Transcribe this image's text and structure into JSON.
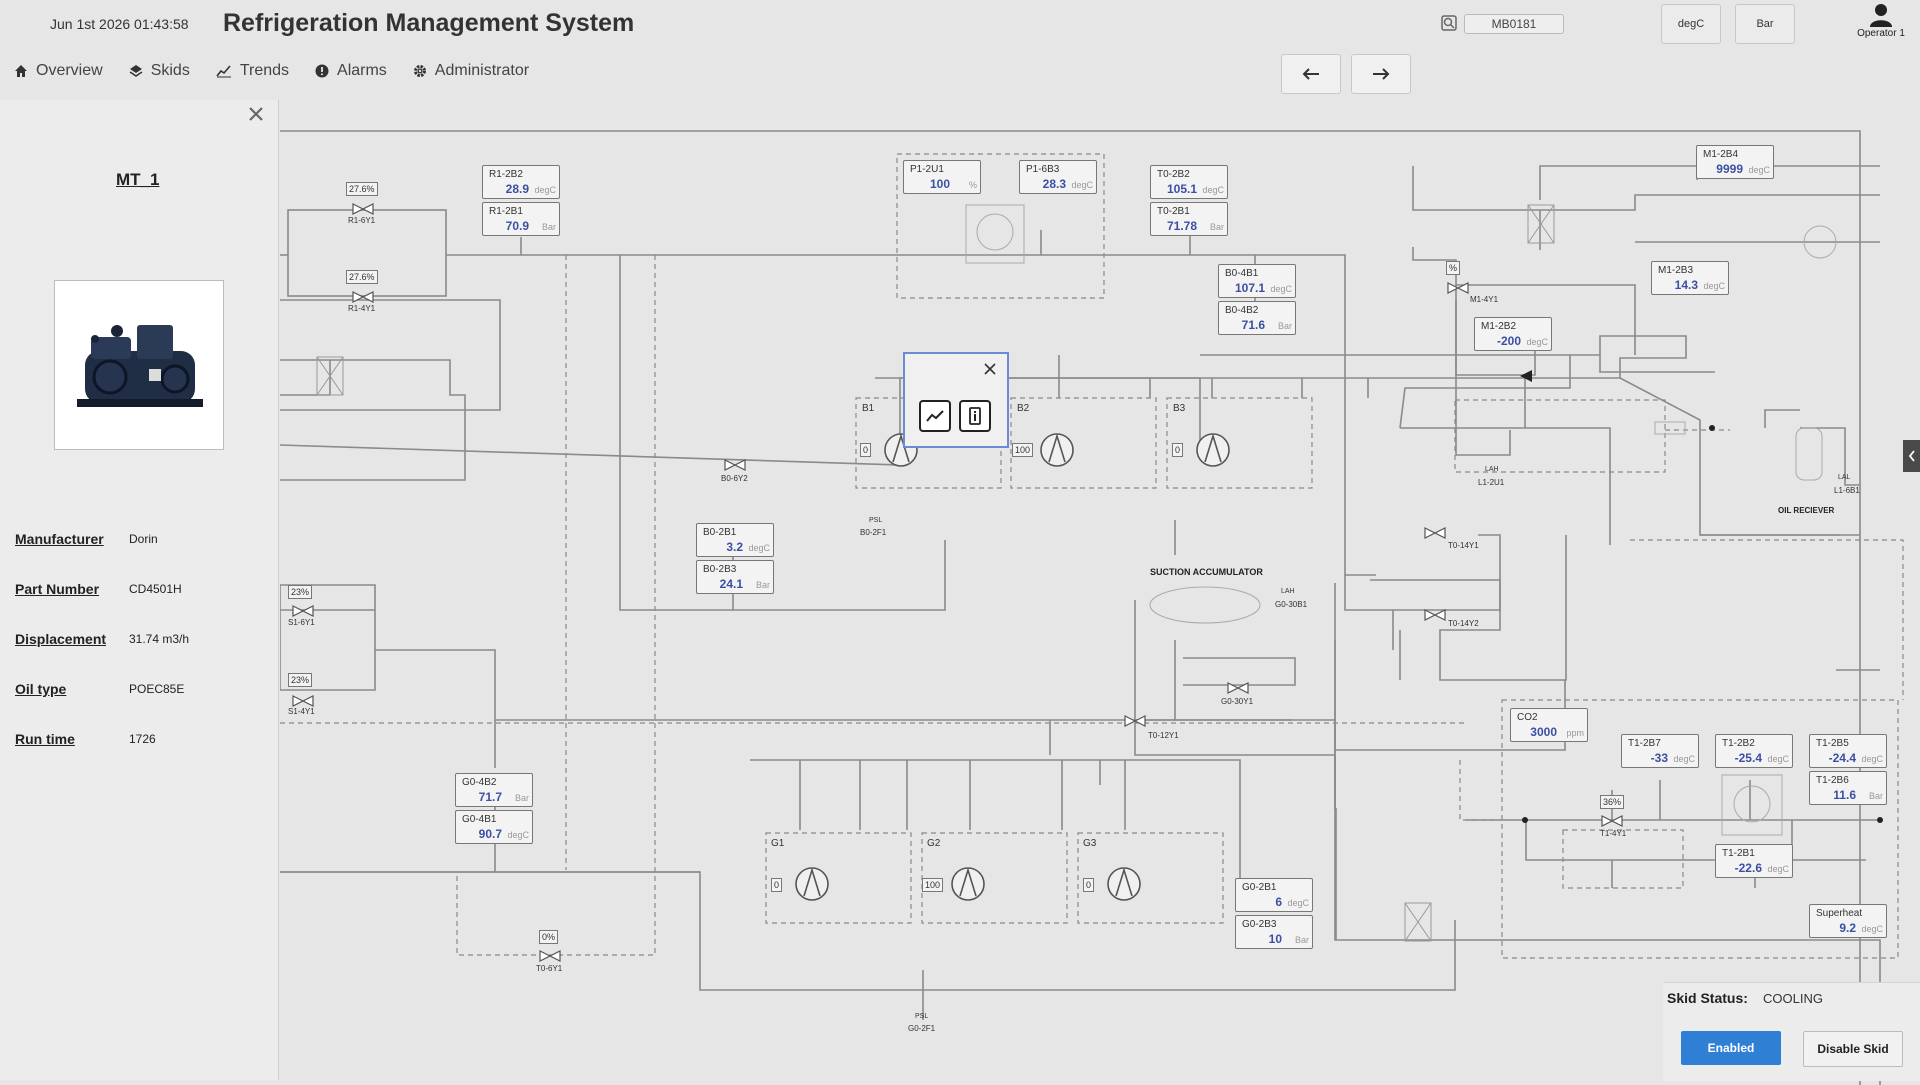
{
  "header": {
    "datetime": "Jun 1st 2026 01:43:58",
    "title": "Refrigeration Management System",
    "search_value": "MB0181",
    "unit_temp": "degC",
    "unit_pressure": "Bar",
    "user": "Operator 1"
  },
  "nav": {
    "items": [
      {
        "label": "Overview",
        "icon": "home-icon"
      },
      {
        "label": "Skids",
        "icon": "layers-icon"
      },
      {
        "label": "Trends",
        "icon": "trend-icon"
      },
      {
        "label": "Alarms",
        "icon": "alert-icon"
      },
      {
        "label": "Administrator",
        "icon": "gear-icon"
      }
    ]
  },
  "panel": {
    "title": "MT_1",
    "properties": [
      {
        "label": "Manufacturer",
        "value": "Dorin"
      },
      {
        "label": "Part Number",
        "value": "CD4501H"
      },
      {
        "label": "Displacement",
        "value": "31.74 m3/h"
      },
      {
        "label": "Oil type",
        "value": "POEC85E"
      },
      {
        "label": "Run time",
        "value": "1726"
      }
    ]
  },
  "sensors": [
    {
      "id": "r1_2b2",
      "tag": "R1-2B2",
      "value": "28.9",
      "unit": "degC"
    },
    {
      "id": "r1_2b1",
      "tag": "R1-2B1",
      "value": "70.9",
      "unit": "Bar"
    },
    {
      "id": "p1_2u1",
      "tag": "P1-2U1",
      "value": "100",
      "unit": "%"
    },
    {
      "id": "p1_6b3",
      "tag": "P1-6B3",
      "value": "28.3",
      "unit": "degC"
    },
    {
      "id": "t0_2b2",
      "tag": "T0-2B2",
      "value": "105.1",
      "unit": "degC"
    },
    {
      "id": "t0_2b1",
      "tag": "T0-2B1",
      "value": "71.78",
      "unit": "Bar"
    },
    {
      "id": "b0_4b1",
      "tag": "B0-4B1",
      "value": "107.1",
      "unit": "degC"
    },
    {
      "id": "b0_4b2",
      "tag": "B0-4B2",
      "value": "71.6",
      "unit": "Bar"
    },
    {
      "id": "m1_2b4",
      "tag": "M1-2B4",
      "value": "9999",
      "unit": "degC"
    },
    {
      "id": "m1_2b3",
      "tag": "M1-2B3",
      "value": "14.3",
      "unit": "degC"
    },
    {
      "id": "m1_2b2",
      "tag": "M1-2B2",
      "value": "-200",
      "unit": "degC"
    },
    {
      "id": "b0_2b1",
      "tag": "B0-2B1",
      "value": "3.2",
      "unit": "degC"
    },
    {
      "id": "b0_2b3",
      "tag": "B0-2B3",
      "value": "24.1",
      "unit": "Bar"
    },
    {
      "id": "g0_4b2",
      "tag": "G0-4B2",
      "value": "71.7",
      "unit": "Bar"
    },
    {
      "id": "g0_4b1",
      "tag": "G0-4B1",
      "value": "90.7",
      "unit": "degC"
    },
    {
      "id": "g0_2b1",
      "tag": "G0-2B1",
      "value": "6",
      "unit": "degC"
    },
    {
      "id": "g0_2b3",
      "tag": "G0-2B3",
      "value": "10",
      "unit": "Bar"
    },
    {
      "id": "co2",
      "tag": "CO2",
      "value": "3000",
      "unit": "ppm"
    },
    {
      "id": "t1_2b7",
      "tag": "T1-2B7",
      "value": "-33",
      "unit": "degC"
    },
    {
      "id": "t1_2b2",
      "tag": "T1-2B2",
      "value": "-25.4",
      "unit": "degC"
    },
    {
      "id": "t1_2b5",
      "tag": "T1-2B5",
      "value": "-24.4",
      "unit": "degC"
    },
    {
      "id": "t1_2b6",
      "tag": "T1-2B6",
      "value": "11.6",
      "unit": "Bar"
    },
    {
      "id": "t1_2b1",
      "tag": "T1-2B1",
      "value": "-22.6",
      "unit": "degC"
    },
    {
      "id": "superheat",
      "tag": "Superheat",
      "value": "9.2",
      "unit": "degC"
    }
  ],
  "valves": {
    "r1_6y1": {
      "pct": "27.6%",
      "tag": "R1-6Y1"
    },
    "r1_4y1": {
      "pct": "27.6%",
      "tag": "R1-4Y1"
    },
    "s1_6y1": {
      "pct": "23%",
      "tag": "S1-6Y1"
    },
    "s1_4y1": {
      "pct": "23%",
      "tag": "S1-4Y1"
    },
    "t0_6y1": {
      "pct": "0%",
      "tag": "T0-6Y1"
    },
    "t1_4y1": {
      "pct": "36%",
      "tag": "T1-4Y1"
    },
    "m1_4y1": {
      "pct": "%",
      "tag": "M1-4Y1"
    },
    "b0_6y2": {
      "tag": "B0-6Y2"
    },
    "t0_14y1": {
      "tag": "T0-14Y1"
    },
    "t0_14y2": {
      "tag": "T0-14Y2"
    },
    "g0_30y1": {
      "tag": "G0-30Y1"
    },
    "t0_12y1": {
      "tag": "T0-12Y1"
    }
  },
  "compressors": {
    "b1": {
      "label": "B1",
      "speed": "0"
    },
    "b2": {
      "label": "B2",
      "speed": "100"
    },
    "b3": {
      "label": "B3",
      "speed": "0"
    },
    "g1": {
      "label": "G1",
      "speed": "0"
    },
    "g2": {
      "label": "G2",
      "speed": "100"
    },
    "g3": {
      "label": "G3",
      "speed": "0"
    }
  },
  "labels": {
    "suction_accumulator": "SUCTION ACCUMULATOR",
    "oil_receiver": "OIL RECIEVER",
    "g0_30b1": "G0-30B1",
    "b0_2f1": "B0-2F1",
    "g0_2f1": "G0-2F1",
    "l1_2u1": "L1-2U1",
    "l1_6b1": "L1-6B1",
    "psl": "PSL",
    "lah": "LAH",
    "lal": "LAL"
  },
  "skid": {
    "status_label": "Skid Status:",
    "status_value": "COOLING",
    "enabled_label": "Enabled",
    "disable_label": "Disable Skid"
  },
  "colors": {
    "accent": "#2f7fd4",
    "value_text": "#3b4fa3",
    "background": "#e6e6e6"
  }
}
